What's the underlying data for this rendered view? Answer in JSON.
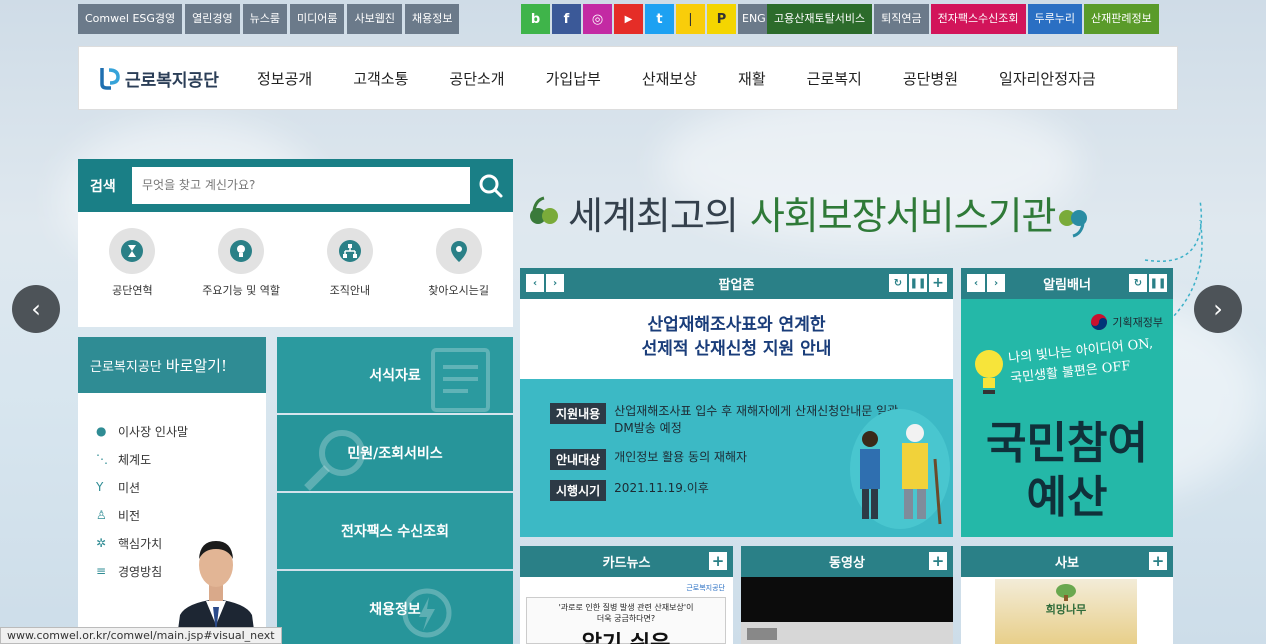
{
  "top_links": [
    "Comwel ESG경영",
    "열린경영",
    "뉴스룸",
    "미디어룸",
    "사보웹진",
    "채용정보"
  ],
  "sns": [
    {
      "icon": "blog-icon",
      "glyph": "b",
      "color": "#3fb44a"
    },
    {
      "icon": "facebook-icon",
      "glyph": "f",
      "color": "#3b5998"
    },
    {
      "icon": "instagram-icon",
      "glyph": "◎",
      "color": "#c32aa3"
    },
    {
      "icon": "youtube-icon",
      "glyph": "▶",
      "color": "#e52d27"
    },
    {
      "icon": "twitter-icon",
      "glyph": "t",
      "color": "#1da1f2"
    },
    {
      "icon": "kakao-story-icon",
      "glyph": "❘",
      "color": "#f9cd0a"
    },
    {
      "icon": "kakao-pay-icon",
      "glyph": "P",
      "color": "#f4d500"
    }
  ],
  "eng_label": "ENG",
  "services": [
    {
      "label": "고용산재토탈서비스",
      "color": "#2c6b2b"
    },
    {
      "label": "퇴직연금",
      "color": "#6b7a8a"
    },
    {
      "label": "전자팩스수신조회",
      "color": "#d2145a"
    },
    {
      "label": "두루누리",
      "color": "#2a6fc3"
    },
    {
      "label": "산재판례정보",
      "color": "#5a9b2a"
    }
  ],
  "logo_text": "근로복지공단",
  "menu": [
    "정보공개",
    "고객소통",
    "공단소개",
    "가입납부",
    "산재보상",
    "재활",
    "근로복지",
    "공단병원",
    "일자리안정자금"
  ],
  "search": {
    "label": "검색",
    "placeholder": "무엇을 찾고 계신가요?"
  },
  "quick_links": [
    {
      "label": "공단연혁",
      "icon": "hourglass-icon"
    },
    {
      "label": "주요기능 및 역할",
      "icon": "lightbulb-icon"
    },
    {
      "label": "조직안내",
      "icon": "org-chart-icon"
    },
    {
      "label": "찾아오시는길",
      "icon": "location-pin-icon"
    }
  ],
  "about": {
    "title": "근로복지공단",
    "title_script": "바로알기!",
    "items": [
      {
        "label": "이사장 인사말",
        "icon": "person-icon"
      },
      {
        "label": "체계도",
        "icon": "structure-icon"
      },
      {
        "label": "미션",
        "icon": "mission-icon"
      },
      {
        "label": "비전",
        "icon": "vision-icon"
      },
      {
        "label": "핵심가치",
        "icon": "core-value-icon"
      },
      {
        "label": "경영방침",
        "icon": "policy-icon"
      }
    ]
  },
  "teal_menu": [
    "서식자료",
    "민원/조회서비스",
    "전자팩스 수신조회",
    "채용정보"
  ],
  "headline": {
    "part1": "세계최고의",
    "part2": "사회보장서비스기관"
  },
  "popup": {
    "title": "팝업존",
    "heading_line1": "산업재해조사표와 연계한",
    "heading_line2": "선제적 산재신청 지원 안내",
    "rows": [
      {
        "key": "지원내용",
        "value": "산업재해조사표 입수 후 재해자에게 산재신청안내문 일괄 DM발송 예정"
      },
      {
        "key": "안내대상",
        "value": "개인정보 활용 동의 재해자"
      },
      {
        "key": "시행시기",
        "value": "2021.11.19.이후"
      }
    ]
  },
  "alert": {
    "title": "알림배너",
    "ministry": "기획재정부",
    "slogan": "나의 빛나는 아이디어 ON, 국민생활 불편은 OFF",
    "big1": "국민참여",
    "big2": "예산"
  },
  "cardnews": {
    "title": "카드뉴스",
    "logo": "근로복지공단",
    "line1": "'과로로 인한 질병 발생 관련 산재보상'이",
    "line2": "더욱 궁금하다면?",
    "big": "알기 쉬운"
  },
  "video": {
    "title": "동영상"
  },
  "sabo": {
    "title": "사보",
    "cover": "희망나무"
  },
  "status_url": "www.comwel.or.kr/comwel/main.jsp#visual_next",
  "colors": {
    "teal": "#2a8087",
    "teal_light": "#2b9a9f",
    "brand_navy": "#2b3e57"
  }
}
